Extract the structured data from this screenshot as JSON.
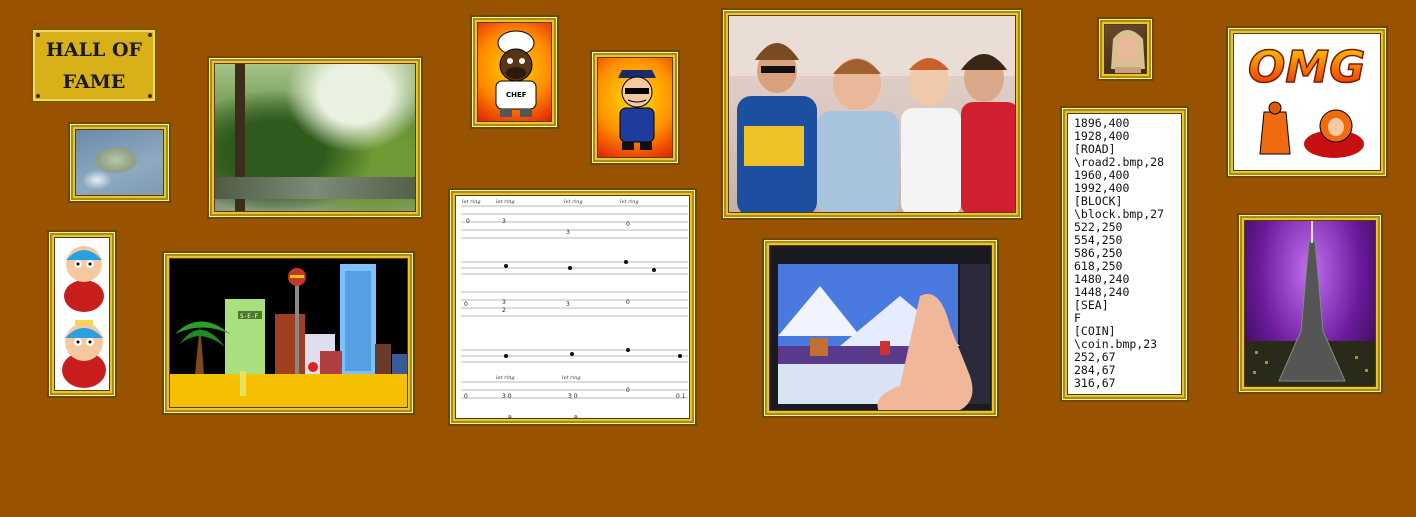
{
  "plaque": {
    "title_line1": "HALL OF",
    "title_line2": "FAME"
  },
  "frames": {
    "omg": {
      "text": "OMG"
    },
    "chef": {
      "label": "CHEF"
    },
    "game": {
      "sign": "S-E-F"
    }
  },
  "config_text": [
    "1896,400",
    "1928,400",
    "[ROAD]",
    "\\road2.bmp,28",
    "1960,400",
    "1992,400",
    "[BLOCK]",
    "\\block.bmp,27",
    "522,250",
    "554,250",
    "586,250",
    "618,250",
    "1480,240",
    "1448,240",
    "[SEA]",
    "F",
    "[COIN]",
    "\\coin.bmp,23",
    "252,67",
    "284,67",
    "316,67"
  ],
  "tab": {
    "let_ring": "let ring",
    "p": "P"
  },
  "colors": {
    "wall": "#995200",
    "frame_gold": "#e8c430"
  }
}
